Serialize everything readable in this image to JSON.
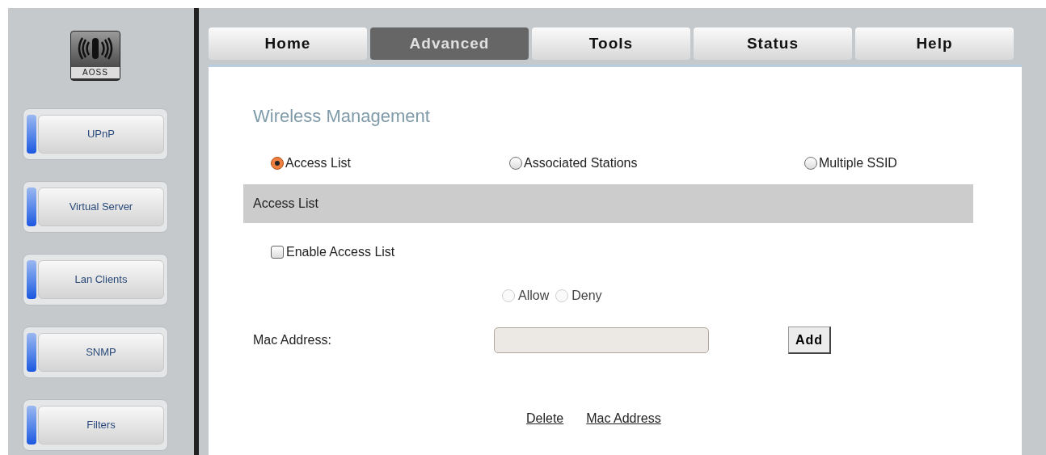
{
  "logo": {
    "text": "AOSS"
  },
  "sidebar": {
    "items": [
      {
        "label": "UPnP"
      },
      {
        "label": "Virtual Server"
      },
      {
        "label": "Lan Clients"
      },
      {
        "label": "SNMP"
      },
      {
        "label": "Filters"
      }
    ]
  },
  "tabs": [
    {
      "label": "Home",
      "selected": false
    },
    {
      "label": "Advanced",
      "selected": true
    },
    {
      "label": "Tools",
      "selected": false
    },
    {
      "label": "Status",
      "selected": false
    },
    {
      "label": "Help",
      "selected": false
    }
  ],
  "title": "Wireless Management",
  "modes": [
    {
      "label": "Access List",
      "selected": true
    },
    {
      "label": "Associated Stations",
      "selected": false
    },
    {
      "label": "Multiple SSID",
      "selected": false
    }
  ],
  "section_header": "Access List",
  "enable_access_list": {
    "label": "Enable Access List",
    "checked": false
  },
  "policy": [
    {
      "label": "Allow",
      "selected": false,
      "disabled": true
    },
    {
      "label": "Deny",
      "selected": false,
      "disabled": true
    }
  ],
  "mac_field": {
    "label": "Mac Address:"
  },
  "add_button": "Add",
  "table": {
    "columns": [
      "Delete",
      "Mac Address"
    ]
  }
}
